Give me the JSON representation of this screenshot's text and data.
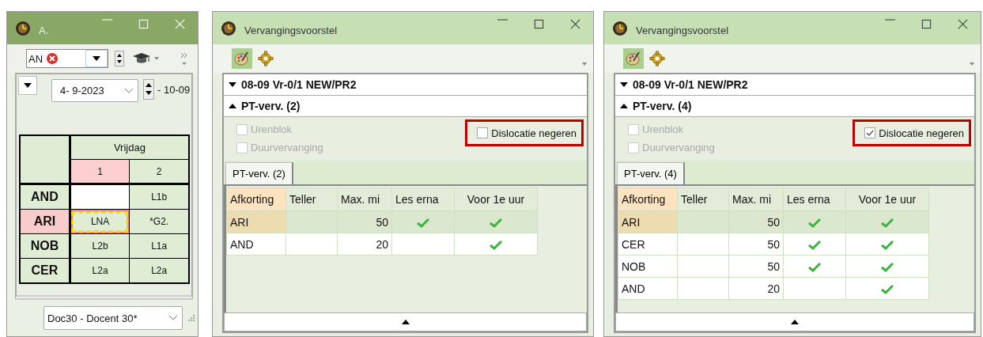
{
  "schedule_window": {
    "title": "A.",
    "filter": {
      "value": "AN"
    },
    "date": {
      "value": "4- 9-2023",
      "end": "- 10-09"
    },
    "table": {
      "day": "Vrijdag",
      "periods": [
        {
          "label": "1",
          "selected": true
        },
        {
          "label": "2",
          "selected": false
        }
      ],
      "rows": [
        {
          "name": "AND",
          "selected": false,
          "cells": [
            {
              "kind": "empty"
            },
            {
              "kind": "lesson",
              "text": "L1b"
            }
          ]
        },
        {
          "name": "ARI",
          "selected": true,
          "cells": [
            {
              "kind": "marked",
              "text": "LNA"
            },
            {
              "kind": "lesson",
              "text": "*G2."
            }
          ]
        },
        {
          "name": "NOB",
          "selected": false,
          "cells": [
            {
              "kind": "lesson",
              "text": "L2b"
            },
            {
              "kind": "lesson",
              "text": "L1a"
            }
          ]
        },
        {
          "name": "CER",
          "selected": false,
          "cells": [
            {
              "kind": "lesson",
              "text": "L2a"
            },
            {
              "kind": "lesson",
              "text": "L2a"
            }
          ]
        }
      ]
    },
    "teacher": {
      "value": "Doc30 - Docent 30*"
    }
  },
  "proposal_windows": [
    {
      "title": "Vervangingsvoorstel",
      "lesson": "08-09 Vr-0/1 NEW/PR2",
      "section": "PT-verv. (2)",
      "options": [
        {
          "label": "Urenblok",
          "checked": false,
          "disabled": true
        },
        {
          "label": "Duurvervanging",
          "checked": false,
          "disabled": true
        }
      ],
      "dislocation": {
        "label": "Dislocatie negeren",
        "checked": false
      },
      "tab": {
        "label": "PT-verv. (2)"
      },
      "columns": [
        "Afkorting",
        "Teller",
        "Max. mi",
        "Les erna",
        "Voor 1e uur"
      ],
      "rows": [
        {
          "abbr": "ARI",
          "max": "50",
          "les_erna": true,
          "voor_1e_uur": true,
          "selected": true
        },
        {
          "abbr": "AND",
          "max": "20",
          "les_erna": false,
          "voor_1e_uur": true,
          "selected": false
        }
      ]
    },
    {
      "title": "Vervangingsvoorstel",
      "lesson": "08-09 Vr-0/1 NEW/PR2",
      "section": "PT-verv. (4)",
      "options": [
        {
          "label": "Urenblok",
          "checked": false,
          "disabled": true
        },
        {
          "label": "Duurvervanging",
          "checked": false,
          "disabled": true
        }
      ],
      "dislocation": {
        "label": "Dislocatie negeren",
        "checked": true
      },
      "tab": {
        "label": "PT-verv. (4)"
      },
      "columns": [
        "Afkorting",
        "Teller",
        "Max. mi",
        "Les erna",
        "Voor 1e uur"
      ],
      "rows": [
        {
          "abbr": "ARI",
          "max": "50",
          "les_erna": true,
          "voor_1e_uur": true,
          "selected": true
        },
        {
          "abbr": "CER",
          "max": "50",
          "les_erna": true,
          "voor_1e_uur": true,
          "selected": false
        },
        {
          "abbr": "NOB",
          "max": "50",
          "les_erna": true,
          "voor_1e_uur": true,
          "selected": false
        },
        {
          "abbr": "AND",
          "max": "20",
          "les_erna": false,
          "voor_1e_uur": true,
          "selected": false
        }
      ]
    }
  ]
}
